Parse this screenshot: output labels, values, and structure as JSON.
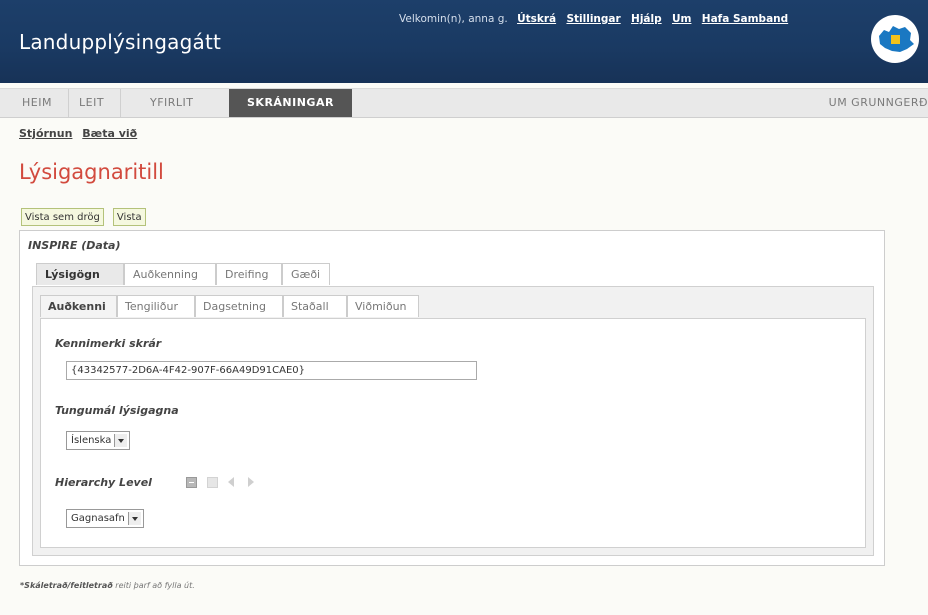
{
  "header": {
    "app_title": "Landupplýsingagátt",
    "welcome": "Velkomin(n), anna g.",
    "links": [
      "Útskrá",
      "Stillingar",
      "Hjálp",
      "Um",
      "Hafa Samband"
    ]
  },
  "mainnav": {
    "tabs": [
      "HEIM",
      "LEIT",
      "YFIRLIT",
      "SKRÁNINGAR"
    ],
    "active": "SKRÁNINGAR",
    "right_link": "UM GRUNNGERÐ"
  },
  "sublinks": [
    "Stjórnun",
    "Bæta við"
  ],
  "page_title": "Lýsigagnaritill",
  "buttons": {
    "view_draft": "Vista sem drög",
    "save": "Vista"
  },
  "editor": {
    "title": "INSPIRE (Data)",
    "main_tabs": [
      "Lýsigögn",
      "Auðkenning",
      "Dreifing",
      "Gæði"
    ],
    "sub_tabs": [
      "Auðkenni",
      "Tengiliður",
      "Dagsetning",
      "Staðall",
      "Viðmiðun"
    ],
    "fields": {
      "file_id_label": "Kennimerki skrár",
      "file_id_value": "{43342577-2D6A-4F42-907F-66A49D91CAE0}",
      "language_label": "Tungumál lýsigagna",
      "language_value": "Íslenska",
      "hierarchy_label": "Hierarchy Level",
      "hierarchy_value": "Gagnasafn"
    }
  },
  "footnote": {
    "bold": "*Skáletrað/feitletrað",
    "rest": " reiti þarf að fylla út."
  },
  "colors": {
    "header_bg": "#1a3a63",
    "title_red": "#d24a3e",
    "active_tab": "#555555"
  }
}
